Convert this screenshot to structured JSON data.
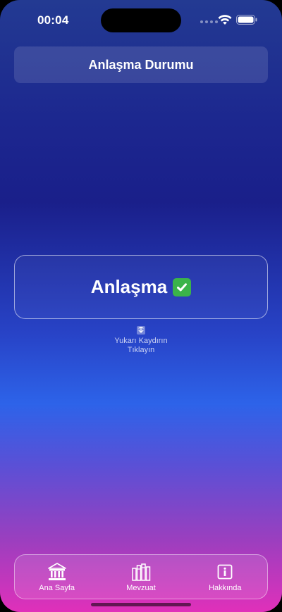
{
  "status_bar": {
    "time": "00:04",
    "icons": [
      "signal-dots-icon",
      "wifi-icon",
      "battery-icon"
    ]
  },
  "header": {
    "title": "Anlaşma Durumu"
  },
  "status_card": {
    "label": "Anlaşma",
    "icon": "check-mark-icon",
    "icon_color": "#3bb34a"
  },
  "hint": {
    "icon": "scroll-down-icon",
    "line1": "Yukarı Kaydırın",
    "line2": "Tıklayın"
  },
  "tab_bar": {
    "tabs": [
      {
        "label": "Ana Sayfa",
        "icon": "courthouse-icon"
      },
      {
        "label": "Mevzuat",
        "icon": "books-icon"
      },
      {
        "label": "Hakkında",
        "icon": "info-icon"
      }
    ]
  },
  "colors": {
    "gradient_top": "#233a92",
    "gradient_mid": "#2d63e9",
    "gradient_bottom": "#e030ba"
  }
}
